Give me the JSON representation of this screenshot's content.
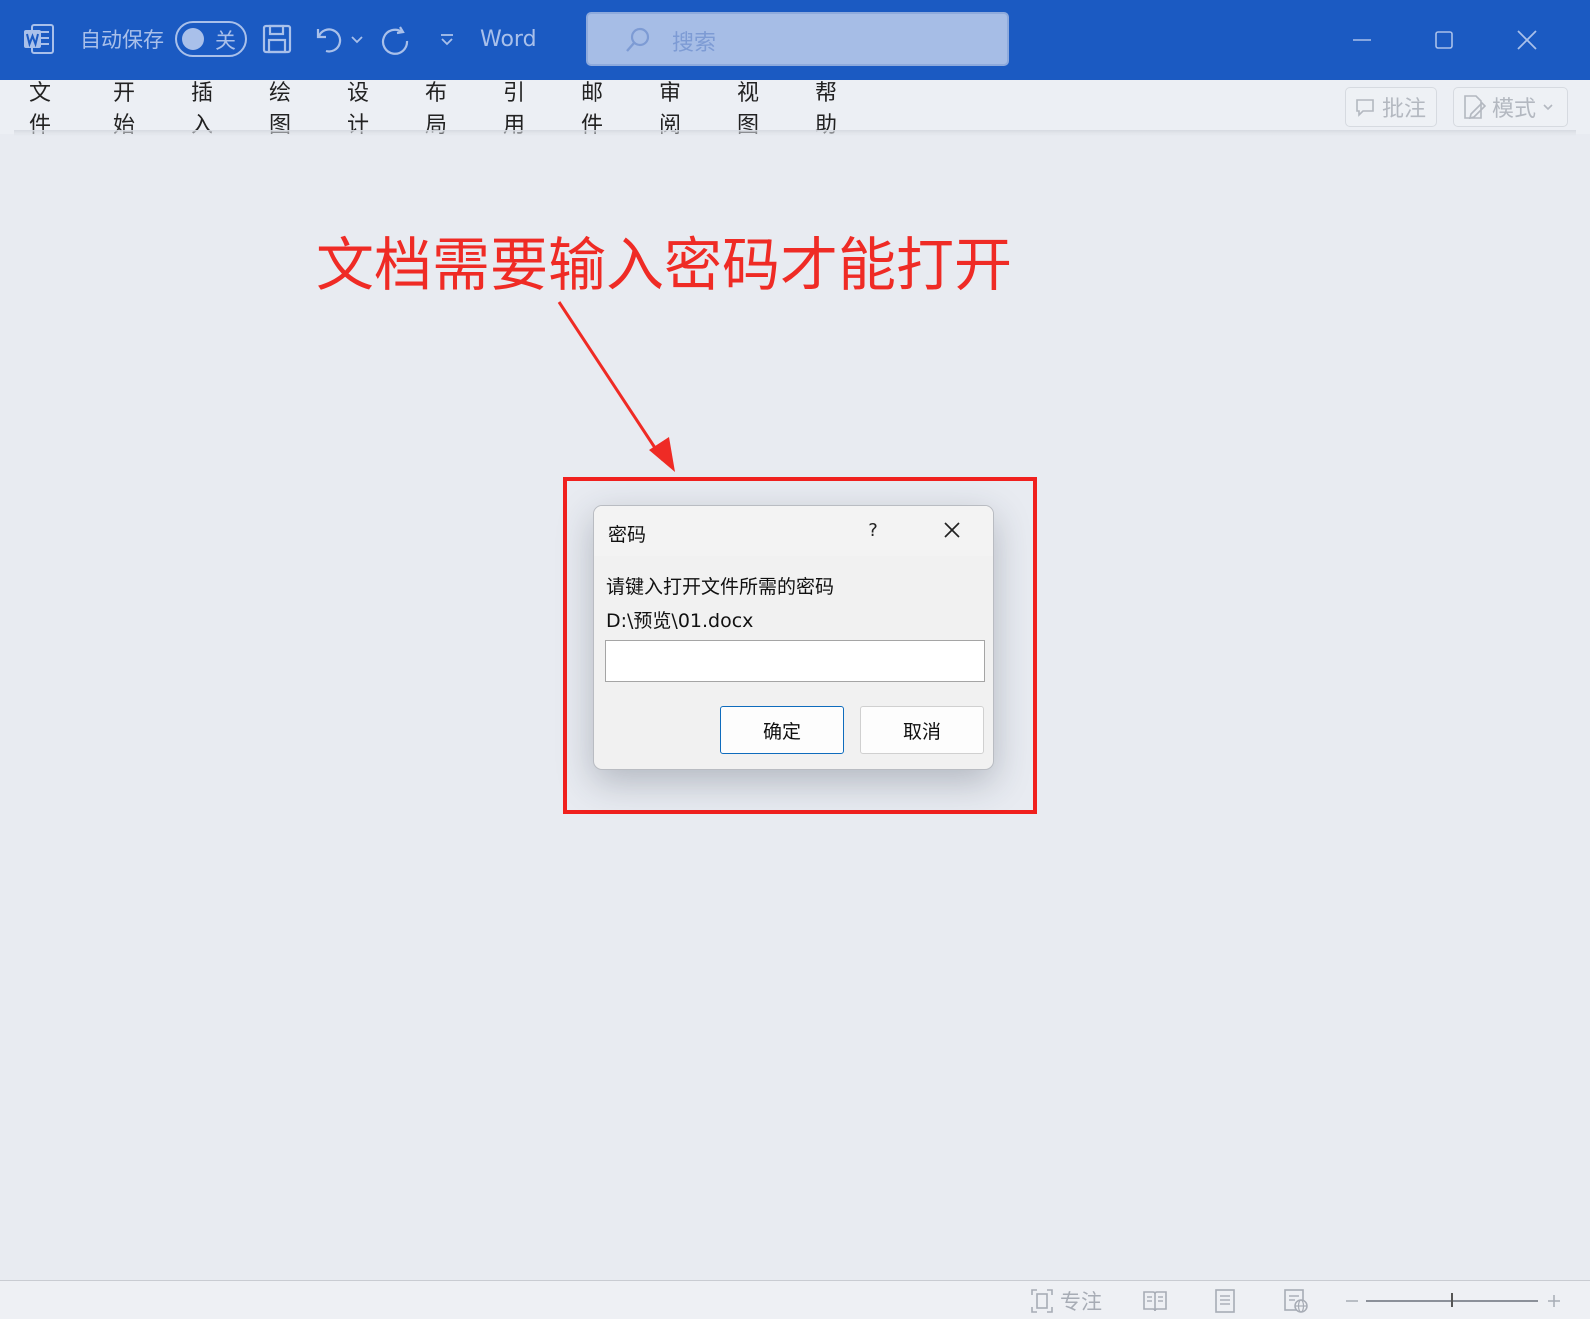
{
  "titlebar": {
    "autosave_label": "自动保存",
    "autosave_state": "关",
    "app_name": "Word",
    "search_placeholder": "搜索"
  },
  "ribbon": {
    "tabs": [
      "文件",
      "开始",
      "插入",
      "绘图",
      "设计",
      "布局",
      "引用",
      "邮件",
      "审阅",
      "视图",
      "帮助"
    ],
    "comment_label": "批注",
    "mode_label": "模式"
  },
  "annotation": {
    "text": "文档需要输入密码才能打开"
  },
  "dialog": {
    "title": "密码",
    "help": "?",
    "prompt": "请键入打开文件所需的密码",
    "file_path": "D:\\预览\\01.docx",
    "password_value": "",
    "ok_label": "确定",
    "cancel_label": "取消"
  },
  "statusbar": {
    "focus_label": "专注"
  },
  "colors": {
    "titlebar_bg": "#1b5ac2",
    "annotation_red": "#ef2b25",
    "ok_border": "#0f6cbd"
  }
}
